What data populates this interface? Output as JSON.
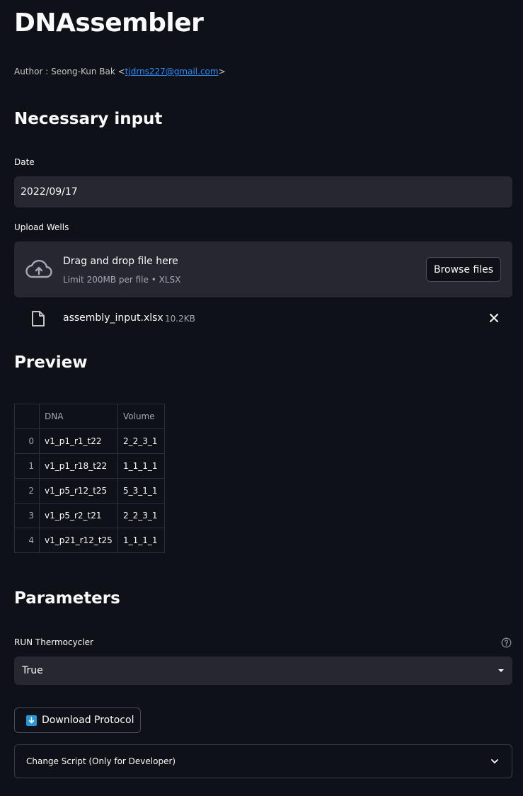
{
  "app": {
    "title": "DNAssembler",
    "author_prefix": "Author : Seong-Kun Bak <",
    "author_email": "tjdrns227@gmail.com",
    "author_suffix": ">"
  },
  "sections": {
    "necessary_input": "Necessary input",
    "preview": "Preview",
    "parameters": "Parameters"
  },
  "date_field": {
    "label": "Date",
    "value": "2022/09/17"
  },
  "upload": {
    "label": "Upload Wells",
    "drop_text": "Drag and drop file here",
    "limit_text": "Limit 200MB per file • XLSX",
    "browse_label": "Browse files",
    "file_name": "assembly_input.xlsx",
    "file_size": "10.2KB"
  },
  "table": {
    "columns": [
      "",
      "DNA",
      "Volume"
    ],
    "rows": [
      [
        "0",
        "v1_p1_r1_t22",
        "2_2_3_1"
      ],
      [
        "1",
        "v1_p1_r18_t22",
        "1_1_1_1"
      ],
      [
        "2",
        "v1_p5_r12_t25",
        "5_3_1_1"
      ],
      [
        "3",
        "v1_p5_r2_t21",
        "2_2_3_1"
      ],
      [
        "4",
        "v1_p21_r12_t25",
        "1_1_1_1"
      ]
    ]
  },
  "thermocycler": {
    "label": "RUN Thermocycler",
    "value": "True"
  },
  "download_button": {
    "label": "Download Protocol"
  },
  "expander": {
    "label": "Change Script (Only for Developer)"
  },
  "icons": {
    "upload": "cloud-upload-icon",
    "file": "file-icon",
    "close": "close-icon",
    "help": "help-icon",
    "download": "download-icon",
    "chevron": "chevron-down-icon"
  },
  "colors": {
    "background": "#0e1117",
    "input_bg": "#262730",
    "link": "#2f8cff",
    "accent": "#2b95d6"
  }
}
